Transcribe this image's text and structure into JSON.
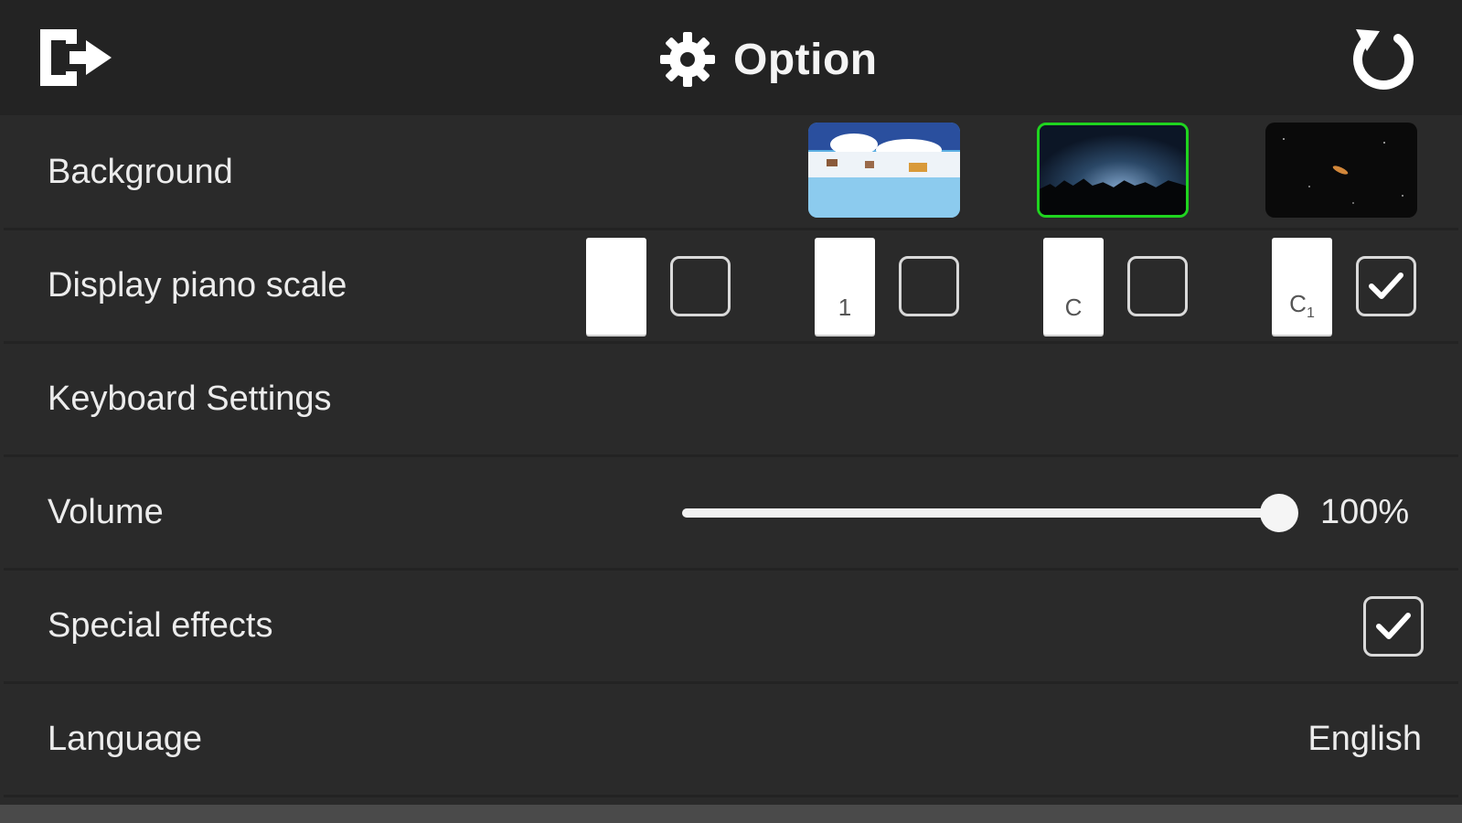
{
  "header": {
    "title": "Option",
    "exit_icon": "exit-icon",
    "settings_icon": "gear-icon",
    "reset_icon": "reset-icon"
  },
  "settings": {
    "background": {
      "label": "Background",
      "options": [
        "snowy-village",
        "night-sky",
        "starfield"
      ],
      "selected_index": 1,
      "selected_border_color": "#1fd41f"
    },
    "piano_scale": {
      "label": "Display piano scale",
      "options": [
        {
          "key_text": "",
          "checked": false
        },
        {
          "key_text": "1",
          "checked": false
        },
        {
          "key_text": "C",
          "checked": false
        },
        {
          "key_text": "C1",
          "checked": true
        }
      ]
    },
    "keyboard": {
      "label": "Keyboard Settings"
    },
    "volume": {
      "label": "Volume",
      "value_text": "100%",
      "level": 1.0
    },
    "effects": {
      "label": "Special effects",
      "checked": true
    },
    "language": {
      "label": "Language",
      "value": "English"
    }
  },
  "colors": {
    "background": "#2a2a2a",
    "header": "#232323",
    "text": "#ececec",
    "accent": "#1fd41f"
  }
}
